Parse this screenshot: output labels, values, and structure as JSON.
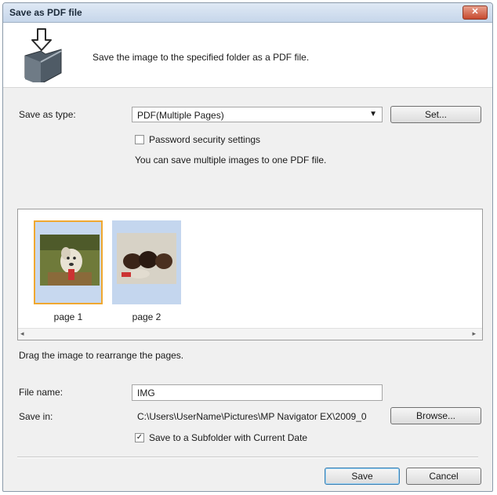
{
  "window": {
    "title": "Save as PDF file",
    "close_glyph": "✕"
  },
  "header": {
    "icon": "save-folder-icon",
    "description": "Save the image to the specified folder as a PDF file."
  },
  "save_type": {
    "label": "Save as type:",
    "value": "PDF(Multiple Pages)",
    "arrow": "▼",
    "set_button": "Set..."
  },
  "password": {
    "label": "Password security settings",
    "checked": false
  },
  "info_text": "You can save multiple images to one PDF file.",
  "pages": [
    {
      "label": "page 1",
      "selected": true
    },
    {
      "label": "page 2",
      "selected": false
    }
  ],
  "scroll": {
    "left": "◂",
    "right": "▸"
  },
  "hint": "Drag the image to rearrange the pages.",
  "file_name": {
    "label": "File name:",
    "value": "IMG"
  },
  "save_in": {
    "label": "Save in:",
    "value": "C:\\Users\\UserName\\Pictures\\MP Navigator EX\\2009_0",
    "browse_button": "Browse..."
  },
  "subfolder": {
    "label": "Save to a Subfolder with Current Date",
    "checked": true,
    "check_glyph": "✓"
  },
  "buttons": {
    "save": "Save",
    "cancel": "Cancel"
  },
  "colors": {
    "selection_border": "#f0a830",
    "thumb_background": "#c4d6ee"
  }
}
